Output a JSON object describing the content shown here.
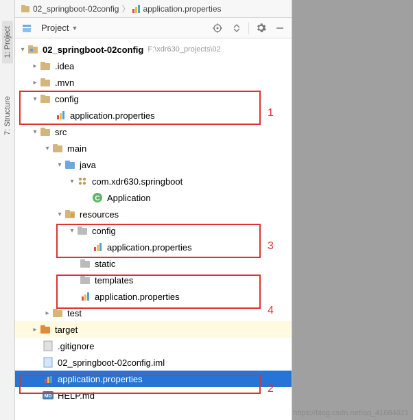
{
  "breadcrumb": {
    "root": "02_springboot-02config",
    "file": "application.properties"
  },
  "toolbar": {
    "project_label": "Project"
  },
  "rail": {
    "project": "1: Project",
    "structure": "7: Structure"
  },
  "tree": {
    "root": {
      "name": "02_springboot-02config",
      "path": "F:\\xdr630_projects\\02"
    },
    "idea": ".idea",
    "mvn": ".mvn",
    "config": "config",
    "config_app": "application.properties",
    "src": "src",
    "main": "main",
    "java": "java",
    "pkg": "com.xdr630.springboot",
    "appcls": "Application",
    "resources": "resources",
    "res_config": "config",
    "res_config_app": "application.properties",
    "static": "static",
    "templates": "templates",
    "res_app": "application.properties",
    "test": "test",
    "target": "target",
    "gitignore": ".gitignore",
    "iml": "02_springboot-02config.iml",
    "root_app": "application.properties",
    "help": "HELP.md"
  },
  "annotations": {
    "n1": "1",
    "n2": "2",
    "n3": "3",
    "n4": "4"
  },
  "watermark": "https://blog.csdn.net/qq_41684621"
}
